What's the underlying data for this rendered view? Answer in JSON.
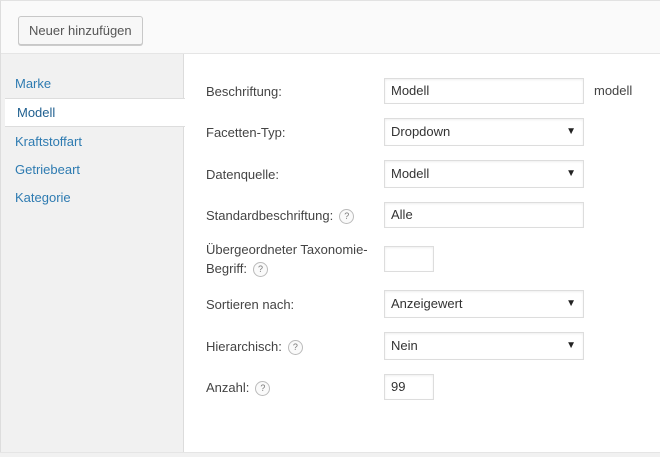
{
  "toolbar": {
    "add_label": "Neuer hinzufügen"
  },
  "sidebar": {
    "items": [
      {
        "label": "Marke"
      },
      {
        "label": "Modell"
      },
      {
        "label": "Kraftstoffart"
      },
      {
        "label": "Getriebeart"
      },
      {
        "label": "Kategorie"
      }
    ],
    "active_index": 1
  },
  "form": {
    "beschriftung": {
      "label": "Beschriftung:",
      "value": "Modell",
      "slug": "modell"
    },
    "facetten_typ": {
      "label": "Facetten-Typ:",
      "value": "Dropdown"
    },
    "datenquelle": {
      "label": "Datenquelle:",
      "value": "Modell"
    },
    "standardbeschriftung": {
      "label": "Standardbeschriftung:",
      "value": "Alle"
    },
    "uebergeordneter": {
      "label_line1": "Übergeordneter Taxonomie-",
      "label_line2": "Begriff:",
      "value": ""
    },
    "sortieren": {
      "label": "Sortieren nach:",
      "value": "Anzeigewert"
    },
    "hierarchisch": {
      "label": "Hierarchisch:",
      "value": "Nein"
    },
    "anzahl": {
      "label": "Anzahl:",
      "value": "99"
    },
    "help_glyph": "?",
    "caret_glyph": "▼"
  }
}
